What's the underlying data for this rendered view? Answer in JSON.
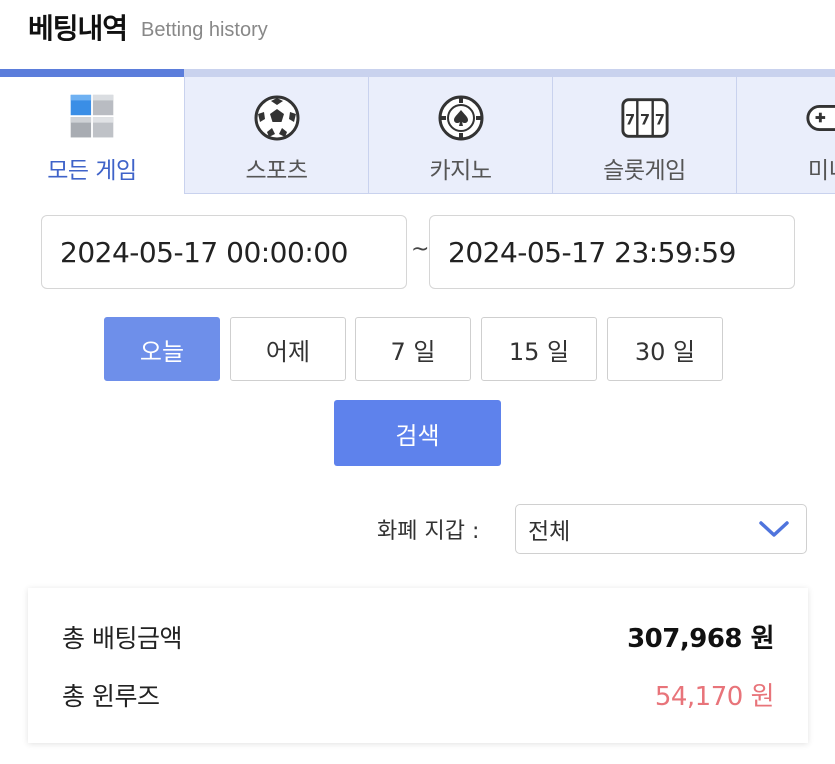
{
  "header": {
    "title_ko": "베팅내역",
    "title_en": "Betting history"
  },
  "tabs": [
    {
      "label": "모든 게임",
      "icon": "cubes-icon",
      "active": true
    },
    {
      "label": "스포츠",
      "icon": "soccer-ball-icon",
      "active": false
    },
    {
      "label": "카지노",
      "icon": "casino-chip-icon",
      "active": false
    },
    {
      "label": "슬롯게임",
      "icon": "slot-machine-icon",
      "active": false
    },
    {
      "label": "미니",
      "icon": "gamepad-icon",
      "active": false
    }
  ],
  "date_range": {
    "start": "2024-05-17 00:00:00",
    "separator": "~",
    "end": "2024-05-17 23:59:59"
  },
  "quick_ranges": [
    {
      "label": "오늘",
      "active": true
    },
    {
      "label": "어제",
      "active": false
    },
    {
      "label": "7 일",
      "active": false
    },
    {
      "label": "15 일",
      "active": false
    },
    {
      "label": "30 일",
      "active": false
    }
  ],
  "search": {
    "label": "검색"
  },
  "wallet": {
    "label": "화폐 지갑 :",
    "selected": "전체"
  },
  "summary": {
    "total_bet_label": "총 배팅금액",
    "total_bet_value": "307,968 원",
    "total_win_label": "총 윈루즈",
    "total_win_value": "54,170 원"
  },
  "colors": {
    "accent": "#5b7ddb",
    "active_quick": "#6e8fea",
    "tab_bg": "#eaeefb",
    "win_value": "#e8747a"
  }
}
